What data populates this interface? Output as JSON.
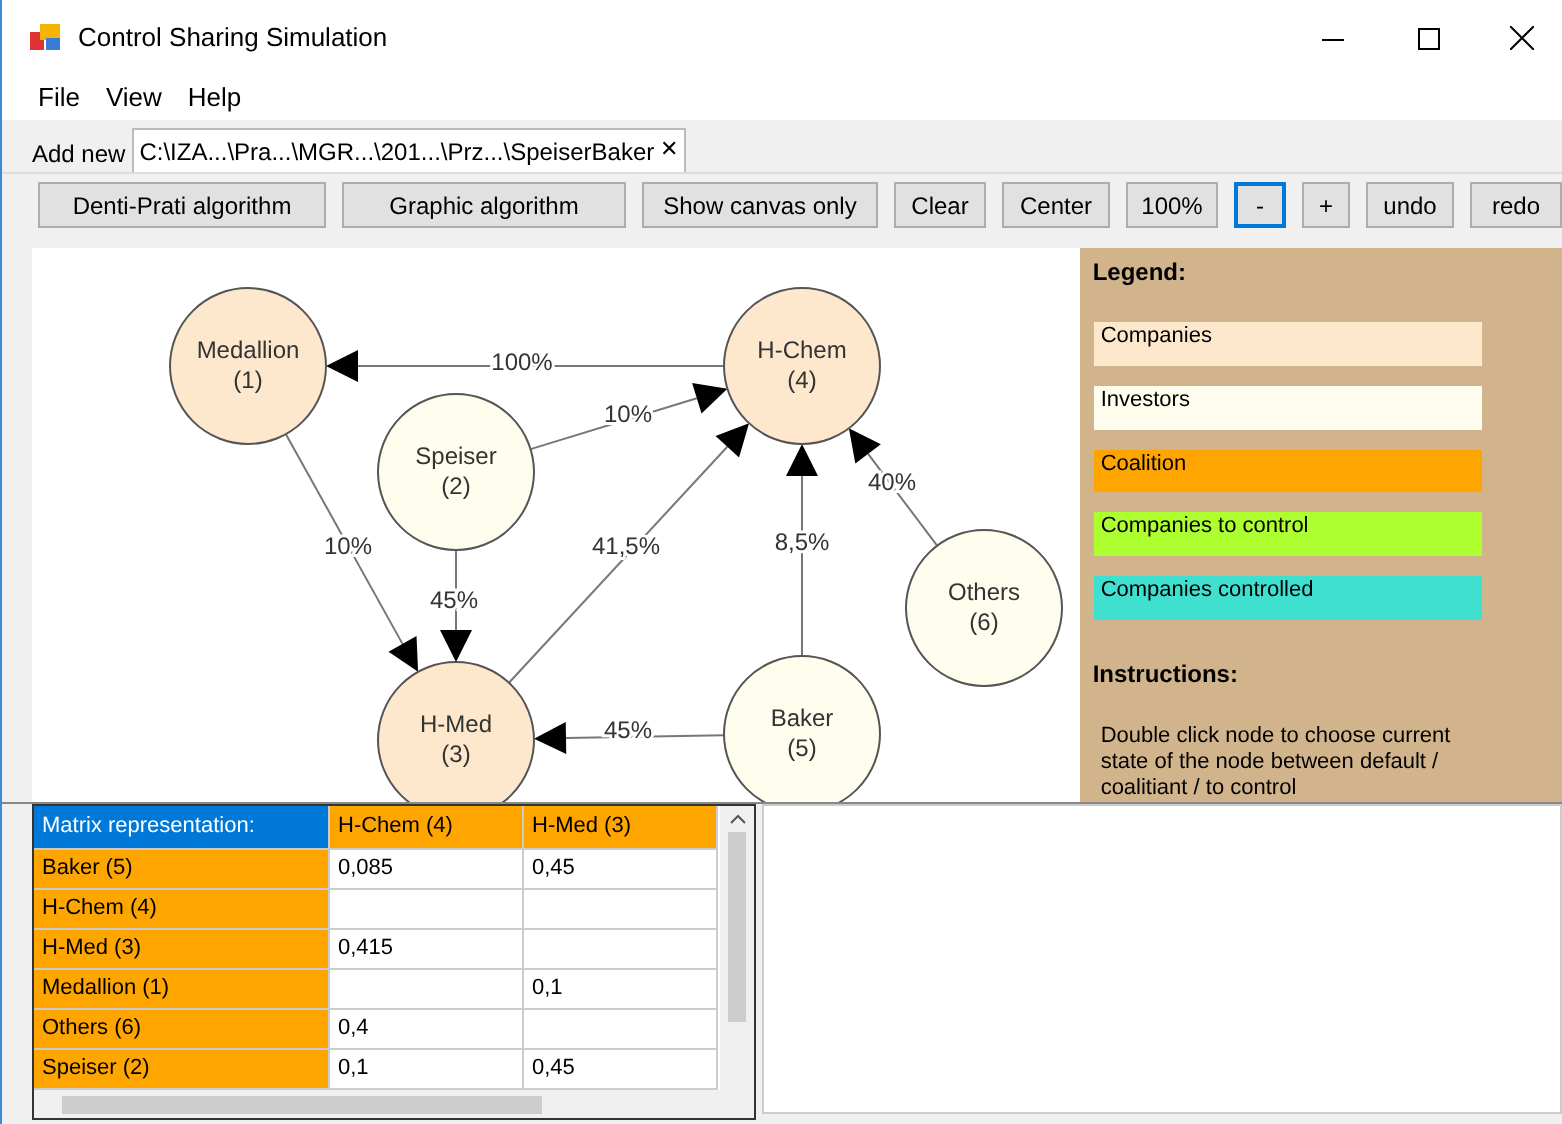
{
  "window": {
    "title": "Control Sharing Simulation"
  },
  "menu": [
    "File",
    "View",
    "Help"
  ],
  "tabs": [
    {
      "label": "Add new",
      "selected": false
    },
    {
      "label": "C:\\IZA...\\Pra...\\MGR...\\201...\\Prz...\\SpeiserBaker",
      "selected": true,
      "close": "✕"
    }
  ],
  "toolbar": [
    {
      "label": "Denti-Prati algorithm",
      "focused": false
    },
    {
      "label": "Graphic algorithm",
      "focused": false
    },
    {
      "label": "Show canvas only",
      "focused": false
    },
    {
      "label": "Clear",
      "focused": false
    },
    {
      "label": "Center",
      "focused": false
    },
    {
      "label": "100%",
      "focused": false
    },
    {
      "label": "-",
      "focused": true
    },
    {
      "label": "+",
      "focused": false
    },
    {
      "label": "undo",
      "focused": false
    },
    {
      "label": "redo",
      "focused": false
    }
  ],
  "graph": {
    "nodes": [
      {
        "name": "Medallion",
        "number": "(1)",
        "kind": "company"
      },
      {
        "name": "Speiser",
        "number": "(2)",
        "kind": "investor"
      },
      {
        "name": "H-Med",
        "number": "(3)",
        "kind": "company"
      },
      {
        "name": "H-Chem",
        "number": "(4)",
        "kind": "company"
      },
      {
        "name": "Baker",
        "number": "(5)",
        "kind": "investor"
      },
      {
        "name": "Others",
        "number": "(6)",
        "kind": "investor"
      }
    ],
    "edges": [
      {
        "label": "100%"
      },
      {
        "label": "10%"
      },
      {
        "label": "10%"
      },
      {
        "label": "45%"
      },
      {
        "label": "41,5%"
      },
      {
        "label": "8,5%"
      },
      {
        "label": "40%"
      },
      {
        "label": "45%"
      }
    ]
  },
  "legend": {
    "title": "Legend:",
    "items": [
      {
        "label": "Companies",
        "color": "#fee8cd"
      },
      {
        "label": "Investors",
        "color": "#fefdee"
      },
      {
        "label": "Coalition",
        "color": "#ffa500"
      },
      {
        "label": "Companies to control",
        "color": "#adff2f"
      },
      {
        "label": "Companies controlled",
        "color": "#40e0d0"
      }
    ],
    "instructions_title": "Instructions:",
    "instructions": "Double click node to choose current state of the node between default / coalitiant / to control"
  },
  "matrix": {
    "corner": "Matrix representation:",
    "columns": [
      "H-Chem (4)",
      "H-Med (3)"
    ],
    "rows": [
      {
        "name": "Baker (5)",
        "value_1": "0,085",
        "value_2": "0,45"
      },
      {
        "name": "H-Chem (4)"
      },
      {
        "name": "H-Med (3)",
        "value_1": "0,415"
      },
      {
        "name": "Medallion (1)",
        "value_2": "0,1"
      },
      {
        "name": "Others (6)",
        "value_1": "0,4"
      },
      {
        "name": "Speiser (2)",
        "value_1": "0,1",
        "value_2": "0,45"
      }
    ]
  }
}
